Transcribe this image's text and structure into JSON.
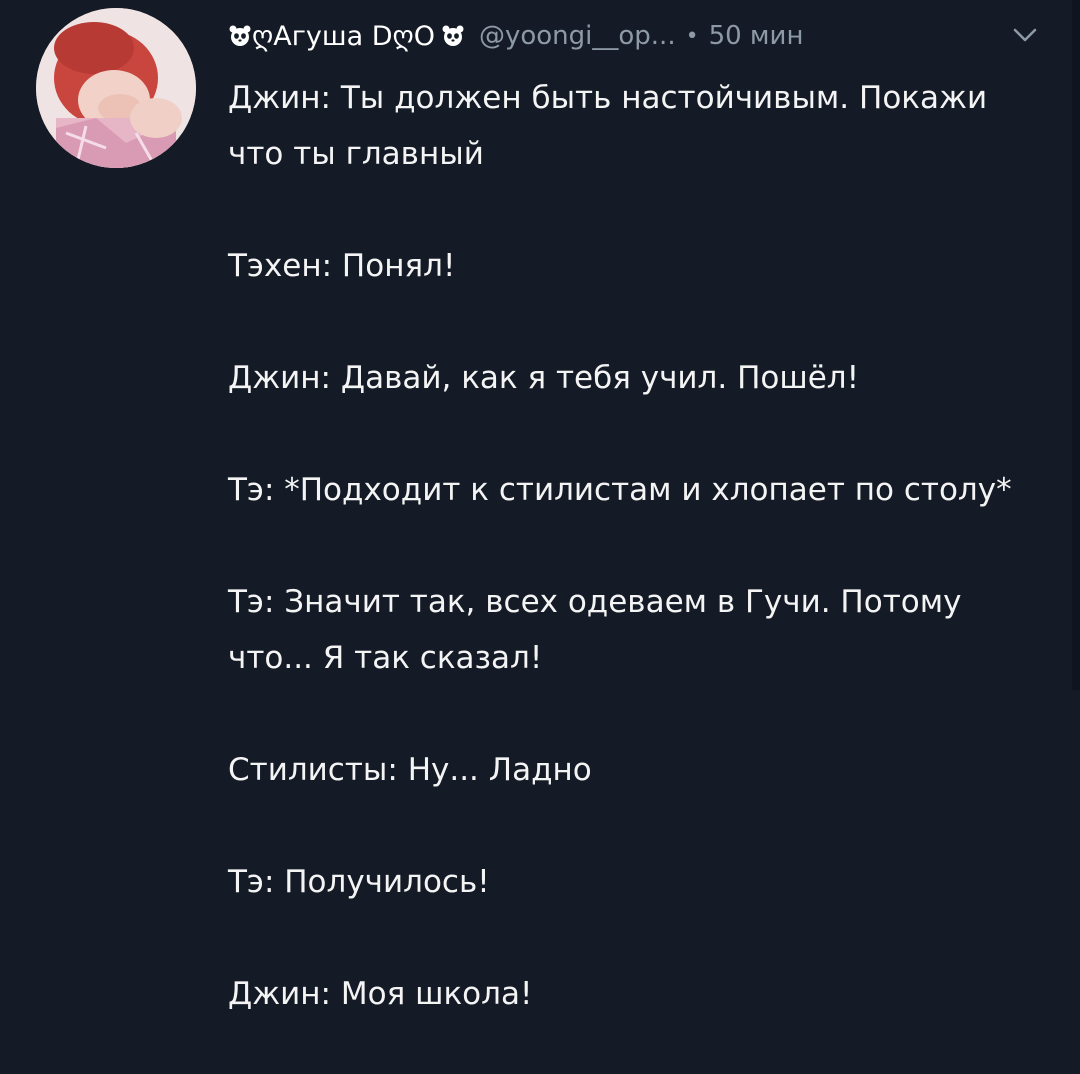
{
  "tweet": {
    "display_name": "ღАгуша DღO",
    "handle": "@yoongi__op...",
    "separator": "•",
    "time": "50 мин",
    "paragraphs": [
      "Джин: Ты должен быть настойчивым. Покажи что ты главный",
      "Тэхен: Понял!",
      "Джин: Давай, как я тебя учил. Пошёл!",
      "Тэ: *Подходит к стилистам и хлопает по столу*",
      "Тэ: Значит так, всех одеваем в Гучи. Потому что... Я так сказал!",
      "Стилисты: Ну... Ладно",
      "Тэ: Получилось!",
      "Джин: Моя школа!"
    ]
  },
  "icons": {
    "avatar": "avatar-photo",
    "name_prefix": "panda-icon",
    "name_suffix": "panda-icon",
    "menu": "chevron-down-icon"
  },
  "colors": {
    "background": "#141b26",
    "text": "#f4f4f4",
    "muted": "#8e99a6"
  }
}
